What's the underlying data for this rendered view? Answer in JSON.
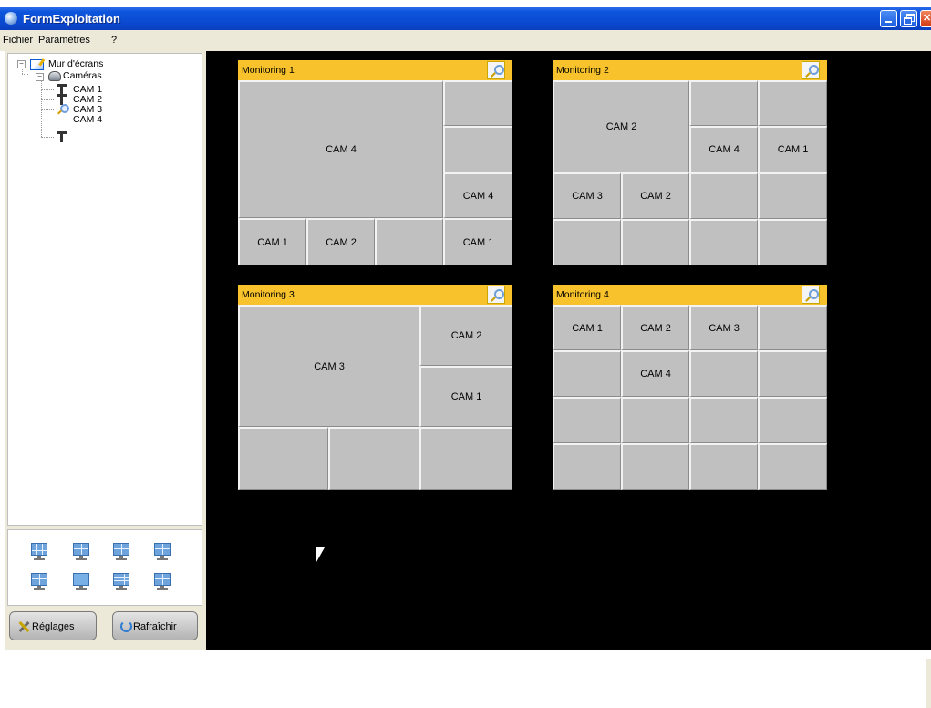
{
  "window": {
    "title": "FormExploitation"
  },
  "menu": {
    "items": [
      "Fichier",
      "Paramètres",
      "?"
    ]
  },
  "tree": {
    "root": "Mur d'écrans",
    "cameras_group": "Caméras",
    "cameras": [
      "CAM 1",
      "CAM 2",
      "CAM 3",
      "CAM 4"
    ]
  },
  "layout_palette": {
    "icons": [
      "grid-4x4-layout-icon",
      "grid-3x3-layout-icon",
      "grid-2x2-layout-icon",
      "grid-1plus-layout-icon",
      "grid-alt-layout-icon",
      "single-layout-icon",
      "grid-3x3-layout-icon-2",
      "grid-mixed-layout-icon"
    ]
  },
  "buttons": {
    "settings": "Réglages",
    "refresh": "Rafraîchir"
  },
  "colors": {
    "panel_header": "#f7c22b",
    "cell": "#c0c0c0",
    "wall": "#000000",
    "titlebar": "#0a4cd3"
  },
  "panels": [
    {
      "title": "Monitoring 1",
      "cells": [
        {
          "label": "CAM 4"
        },
        {
          "label": ""
        },
        {
          "label": ""
        },
        {
          "label": "CAM 4"
        },
        {
          "label": "CAM 1"
        },
        {
          "label": "CAM 2"
        },
        {
          "label": ""
        },
        {
          "label": "CAM 1"
        }
      ]
    },
    {
      "title": "Monitoring 2",
      "cells": [
        {
          "label": "CAM 2"
        },
        {
          "label": ""
        },
        {
          "label": ""
        },
        {
          "label": "CAM 4"
        },
        {
          "label": "CAM 1"
        },
        {
          "label": "CAM 3"
        },
        {
          "label": "CAM 2"
        },
        {
          "label": ""
        },
        {
          "label": ""
        },
        {
          "label": ""
        },
        {
          "label": ""
        },
        {
          "label": ""
        },
        {
          "label": ""
        }
      ]
    },
    {
      "title": "Monitoring 3",
      "cells": [
        {
          "label": "CAM 3"
        },
        {
          "label": "CAM 2"
        },
        {
          "label": "CAM 1"
        },
        {
          "label": ""
        },
        {
          "label": ""
        },
        {
          "label": ""
        }
      ]
    },
    {
      "title": "Monitoring 4",
      "cells": [
        {
          "label": "CAM 1"
        },
        {
          "label": "CAM 2"
        },
        {
          "label": "CAM 3"
        },
        {
          "label": ""
        },
        {
          "label": ""
        },
        {
          "label": "CAM 4"
        },
        {
          "label": ""
        },
        {
          "label": ""
        },
        {
          "label": ""
        },
        {
          "label": ""
        },
        {
          "label": ""
        },
        {
          "label": ""
        },
        {
          "label": ""
        },
        {
          "label": ""
        },
        {
          "label": ""
        },
        {
          "label": ""
        }
      ]
    }
  ]
}
